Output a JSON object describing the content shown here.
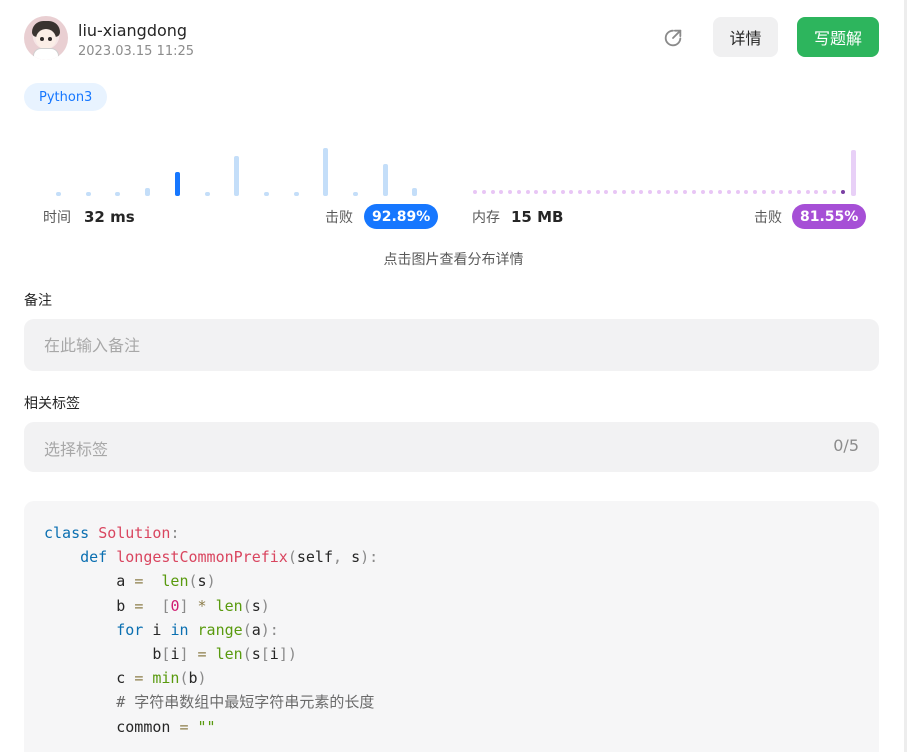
{
  "user": {
    "name": "liu-xiangdong",
    "datetime": "2023.03.15 11:25"
  },
  "actions": {
    "detail_label": "详情",
    "write_solution_label": "写题解",
    "share_icon": "share-arrow-icon"
  },
  "language": "Python3",
  "runtime": {
    "label": "时间",
    "value": "32 ms",
    "beats_label": "击败",
    "beats_pct": "92.89%",
    "accent": "#1677ff",
    "distribution": [
      1,
      1,
      1,
      2,
      6,
      1,
      10,
      1,
      1,
      12,
      1,
      8,
      2
    ],
    "selected_index": 4
  },
  "memory": {
    "label": "内存",
    "value": "15 MB",
    "beats_label": "击败",
    "beats_pct": "81.55%",
    "accent": "#a64fd6"
  },
  "hint": "点击图片查看分布详情",
  "note": {
    "label": "备注",
    "placeholder": "在此输入备注"
  },
  "tags": {
    "label": "相关标签",
    "placeholder": "选择标签",
    "count": "0/5"
  },
  "code": {
    "language": "python",
    "lines": [
      [
        [
          "kw",
          "class "
        ],
        [
          "fn",
          "Solution"
        ],
        [
          "pu",
          ":"
        ]
      ],
      [
        [
          "",
          "    "
        ],
        [
          "kw",
          "def "
        ],
        [
          "fn",
          "longestCommonPrefix"
        ],
        [
          "pu",
          "("
        ],
        [
          "",
          "self"
        ],
        [
          "pu",
          ", "
        ],
        [
          "",
          "s"
        ],
        [
          "pu",
          "):"
        ]
      ],
      [
        [
          "",
          "        a "
        ],
        [
          "op",
          "="
        ],
        [
          "",
          "  "
        ],
        [
          "bi",
          "len"
        ],
        [
          "pu",
          "("
        ],
        [
          "",
          "s"
        ],
        [
          "pu",
          ")"
        ]
      ],
      [
        [
          "",
          "        b "
        ],
        [
          "op",
          "="
        ],
        [
          "",
          "  "
        ],
        [
          "pu",
          "["
        ],
        [
          "num",
          "0"
        ],
        [
          "pu",
          "] "
        ],
        [
          "op",
          "*"
        ],
        [
          "",
          " "
        ],
        [
          "bi",
          "len"
        ],
        [
          "pu",
          "("
        ],
        [
          "",
          "s"
        ],
        [
          "pu",
          ")"
        ]
      ],
      [
        [
          "",
          "        "
        ],
        [
          "kw",
          "for "
        ],
        [
          "",
          "i "
        ],
        [
          "kw",
          "in "
        ],
        [
          "bi",
          "range"
        ],
        [
          "pu",
          "("
        ],
        [
          "",
          "a"
        ],
        [
          "pu",
          "):"
        ]
      ],
      [
        [
          "",
          "            b"
        ],
        [
          "pu",
          "["
        ],
        [
          "",
          "i"
        ],
        [
          "pu",
          "] "
        ],
        [
          "op",
          "="
        ],
        [
          "",
          " "
        ],
        [
          "bi",
          "len"
        ],
        [
          "pu",
          "("
        ],
        [
          "",
          "s"
        ],
        [
          "pu",
          "["
        ],
        [
          "",
          "i"
        ],
        [
          "pu",
          "])"
        ]
      ],
      [
        [
          "",
          "        c "
        ],
        [
          "op",
          "="
        ],
        [
          "",
          " "
        ],
        [
          "bi",
          "min"
        ],
        [
          "pu",
          "("
        ],
        [
          "",
          "b"
        ],
        [
          "pu",
          ")"
        ]
      ],
      [
        [
          "",
          "        "
        ],
        [
          "cm",
          "# 字符串数组中最短字符串元素的长度"
        ]
      ],
      [
        [
          "",
          "        common "
        ],
        [
          "op",
          "="
        ],
        [
          "",
          " "
        ],
        [
          "st",
          "\"\""
        ]
      ]
    ]
  }
}
